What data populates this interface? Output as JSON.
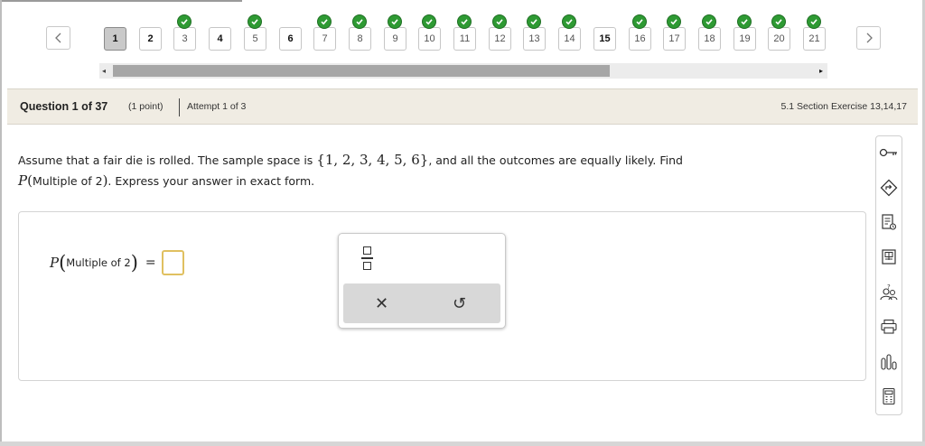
{
  "nav": {
    "prev_icon": "chevron-left-icon",
    "next_icon": "chevron-right-icon",
    "questions": [
      {
        "label": "1",
        "state": "current"
      },
      {
        "label": "2",
        "state": "unanswered"
      },
      {
        "label": "3",
        "state": "correct"
      },
      {
        "label": "4",
        "state": "unanswered"
      },
      {
        "label": "5",
        "state": "correct"
      },
      {
        "label": "6",
        "state": "unanswered"
      },
      {
        "label": "7",
        "state": "correct"
      },
      {
        "label": "8",
        "state": "correct"
      },
      {
        "label": "9",
        "state": "correct"
      },
      {
        "label": "10",
        "state": "correct"
      },
      {
        "label": "11",
        "state": "correct"
      },
      {
        "label": "12",
        "state": "correct"
      },
      {
        "label": "13",
        "state": "correct"
      },
      {
        "label": "14",
        "state": "correct"
      },
      {
        "label": "15",
        "state": "unanswered"
      },
      {
        "label": "16",
        "state": "correct"
      },
      {
        "label": "17",
        "state": "correct"
      },
      {
        "label": "18",
        "state": "correct"
      },
      {
        "label": "19",
        "state": "correct"
      },
      {
        "label": "20",
        "state": "correct"
      },
      {
        "label": "21",
        "state": "correct"
      }
    ],
    "check_color": "#2e9a33"
  },
  "header": {
    "title": "Question 1 of 37",
    "points": "(1 point)",
    "attempt": "Attempt 1 of 3",
    "section": "5.1 Section Exercise 13,14,17"
  },
  "question": {
    "part1": "Assume that a fair die is rolled. The sample space is ",
    "sample_space": "{1, 2, 3, 4, 5, 6}",
    "part2": ", and all the outcomes are equally likely. Find",
    "p_symbol": "P",
    "event": "Multiple of 2",
    "part3": ". Express your answer in exact form."
  },
  "answer": {
    "p_symbol": "P",
    "event_text": "Multiple of 2",
    "equals": "=",
    "input_value": ""
  },
  "palette": {
    "fraction_icon": "fraction-icon",
    "clear_symbol": "✕",
    "undo_symbol": "↺"
  },
  "toolbar": {
    "tools": [
      "key-icon",
      "direction-sign-icon",
      "checklist-icon",
      "textbook-icon",
      "ask-help-icon",
      "print-icon",
      "statistics-icon",
      "calculator-icon"
    ]
  }
}
